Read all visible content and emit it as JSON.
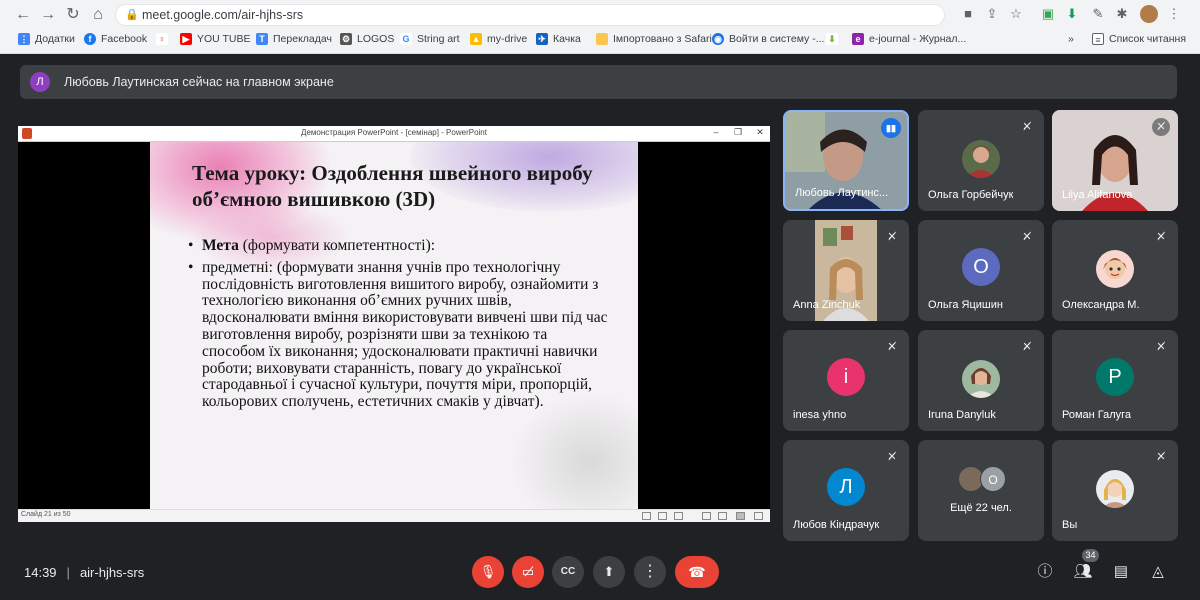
{
  "browser": {
    "url": "meet.google.com/air-hjhs-srs",
    "bookmarks": [
      "Додатки",
      "Facebook",
      "YOU TUBE",
      "Перекладач",
      "LOGOS",
      "String art",
      "my-drive",
      "Качка",
      "Імпортовано з Safari",
      "Войти в систему -...",
      "e-journal - Журнал..."
    ],
    "reading_list": "Список читання"
  },
  "presenting": {
    "avatar_letter": "Л",
    "text": "Любовь Лаутинская сейчас на главном экране"
  },
  "powerpoint": {
    "window_title": "Демонстрация PowerPoint - [семінар] - PowerPoint",
    "slide_title": "Тема уроку: Оздоблення швейного виробу об’ємною вишивкою  (3D)",
    "bullet1_bold": "Мета",
    "bullet1_rest": " (формувати компетентності):",
    "bullet2": "предметні: (формувати знання учнів про технологічну послідовність виготовлення вишитого виробу, ознайомити з технологією виконання об’ємних  ручних швів, вдосконалювати вміння використовувати вивчені шви під час виготовлення виробу, розрізняти шви за технікою та способом їх виконання; удосконалювати практичні навички роботи; виховувати старанність, повагу до української стародавньої і сучасної культури, почуття міри, пропорцій, кольорових сполучень, естетичних смаків у дівчат).",
    "status": "Слайд 21 из 50"
  },
  "participants": [
    {
      "name": "Любовь Лаутинс...",
      "type": "video",
      "speaking": true
    },
    {
      "name": "Ольга Горбейчук",
      "type": "photo",
      "muted": true
    },
    {
      "name": "Lilya Alifanova",
      "type": "video",
      "muted": true
    },
    {
      "name": "Anna Zinchuk",
      "type": "video",
      "muted": true
    },
    {
      "name": "Ольга Яцишин",
      "type": "letter",
      "letter": "О",
      "color": "#5c6bc0",
      "muted": true
    },
    {
      "name": "Олександра М.",
      "type": "photo",
      "muted": true
    },
    {
      "name": "inesa yhno",
      "type": "letter",
      "letter": "i",
      "color": "#e8336d",
      "muted": true
    },
    {
      "name": "Iruna Danyluk",
      "type": "photo",
      "muted": true
    },
    {
      "name": "Роман Галуга",
      "type": "letter",
      "letter": "Р",
      "color": "#00796b",
      "muted": true
    },
    {
      "name": "Любов Кіндрачук",
      "type": "letter",
      "letter": "Л",
      "color": "#0288d1",
      "muted": true
    },
    {
      "name": "Ещё 22 чел.",
      "type": "more",
      "letter": "О"
    },
    {
      "name": "Вы",
      "type": "photo",
      "muted": true
    }
  ],
  "bottom": {
    "time": "14:39",
    "meeting_code": "air-hjhs-srs",
    "people_count": "34"
  },
  "colors": {
    "accent_blue": "#1a73e8",
    "red": "#ea4335",
    "tile_bg": "#3c4043",
    "page_bg": "#202124"
  }
}
